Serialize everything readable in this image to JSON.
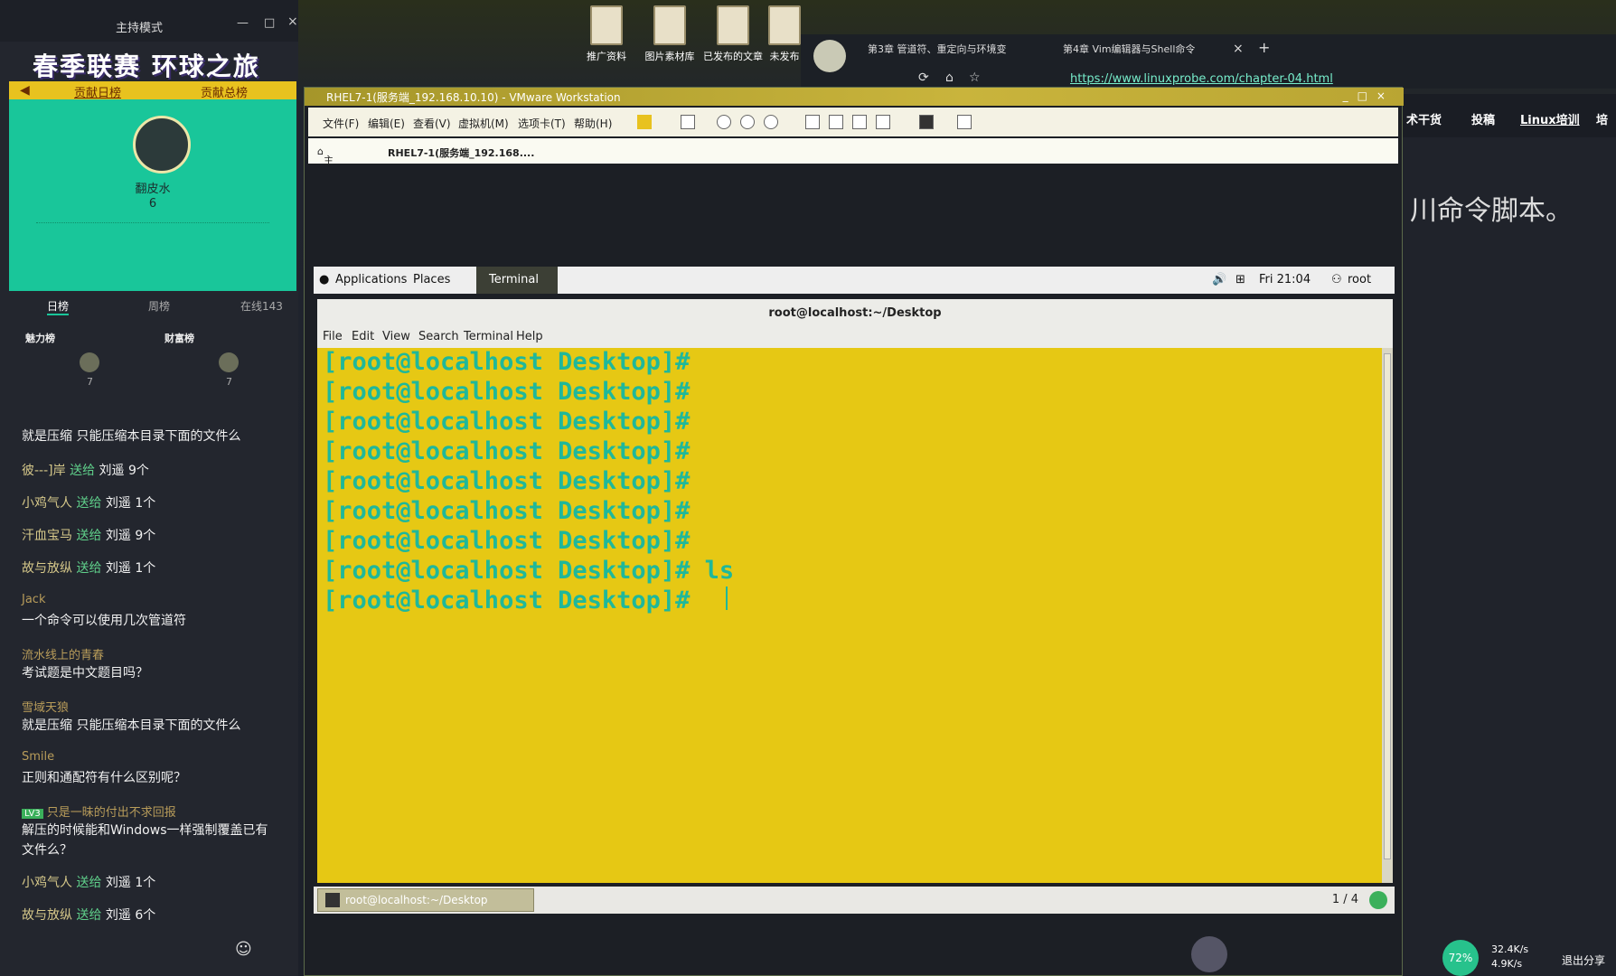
{
  "desktop": {
    "icons": [
      "推广资料",
      "图片素材库",
      "已发布的文章",
      "未发布"
    ]
  },
  "live": {
    "header_mode": "主持模式",
    "banner": "春季联赛 环球之旅",
    "tabs": [
      "贡献日榜",
      "贡献总榜"
    ],
    "top_user": {
      "name": "翻皮水",
      "score": "6"
    },
    "rank_tabs": [
      "日榜",
      "周榜",
      "在线143"
    ],
    "rank_lists": [
      {
        "title": "魅力榜",
        "value": "7"
      },
      {
        "title": "财富榜",
        "value": "7"
      }
    ],
    "messages": [
      {
        "type": "text",
        "text": "就是压缩 只能压缩本目录下面的文件么"
      },
      {
        "type": "gift",
        "who": "彼---]岸",
        "verb": "送给",
        "target": "刘遥",
        "count": "9个"
      },
      {
        "type": "gift",
        "who": "小鸡气人",
        "verb": "送给",
        "target": "刘遥",
        "count": "1个"
      },
      {
        "type": "gift",
        "who": "汗血宝马",
        "verb": "送给",
        "target": "刘遥",
        "count": "9个"
      },
      {
        "type": "gift",
        "who": "故与放纵",
        "verb": "送给",
        "target": "刘遥",
        "count": "1个"
      },
      {
        "type": "name",
        "text": "Jack"
      },
      {
        "type": "text",
        "text": "一个命令可以使用几次管道符"
      },
      {
        "type": "name",
        "text": "流水线上的青春"
      },
      {
        "type": "text",
        "text": "考试题是中文题目吗？"
      },
      {
        "type": "name",
        "text": "雪域天狼"
      },
      {
        "type": "text",
        "text": "就是压缩 只能压缩本目录下面的文件么"
      },
      {
        "type": "name",
        "text": "Smile"
      },
      {
        "type": "text",
        "text": "正则和通配符有什么区别呢？"
      },
      {
        "type": "name",
        "text": "只是一昧的付出不求回报",
        "badge": "LV3"
      },
      {
        "type": "text",
        "text": "解压的时候能和Windows一样强制覆盖已有"
      },
      {
        "type": "text",
        "text": "文件么？"
      },
      {
        "type": "gift",
        "who": "小鸡气人",
        "verb": "送给",
        "target": "刘遥",
        "count": "1个"
      },
      {
        "type": "gift",
        "who": "故与放纵",
        "verb": "送给",
        "target": "刘遥",
        "count": "6个"
      }
    ]
  },
  "browser": {
    "tabs": [
      "第3章 管道符、重定向与环境变",
      "第4章 Vim编辑器与Shell命令"
    ],
    "url": "https://www.linuxprobe.com/chapter-04.html",
    "nav": [
      "术干货",
      "投稿",
      "Linux培训",
      "培"
    ],
    "heading": "川命令脚本。"
  },
  "vmware": {
    "title": "RHEL7-1(服务端_192.168.10.10) - VMware Workstation",
    "menu": [
      "文件(F)",
      "编辑(E)",
      "查看(V)",
      "虚拟机(M)",
      "选项卡(T)",
      "帮助(H)"
    ],
    "tabs": [
      "主页",
      "RHEL7-1(服务端_192.168...."
    ]
  },
  "gnome": {
    "applications": "Applications",
    "places": "Places",
    "terminal": "Terminal",
    "clock": "Fri 21:04",
    "user": "root"
  },
  "terminal": {
    "title": "root@localhost:~/Desktop",
    "menu": [
      "File",
      "Edit",
      "View",
      "Search",
      "Terminal",
      "Help"
    ],
    "lines": [
      "[root@localhost Desktop]#",
      "[root@localhost Desktop]#",
      "[root@localhost Desktop]#",
      "[root@localhost Desktop]#",
      "[root@localhost Desktop]#",
      "[root@localhost Desktop]#",
      "[root@localhost Desktop]#",
      "[root@localhost Desktop]# ls",
      "[root@localhost Desktop]# "
    ],
    "colors": {
      "background": "#e6c814",
      "text": "#1fb89a"
    }
  },
  "guest_bar": {
    "task": "root@localhost:~/Desktop",
    "pager": "1 / 4"
  },
  "tray": {
    "percent": "72%",
    "up": "32.4K/s",
    "down": "4.9K/s",
    "share": "退出分享"
  }
}
